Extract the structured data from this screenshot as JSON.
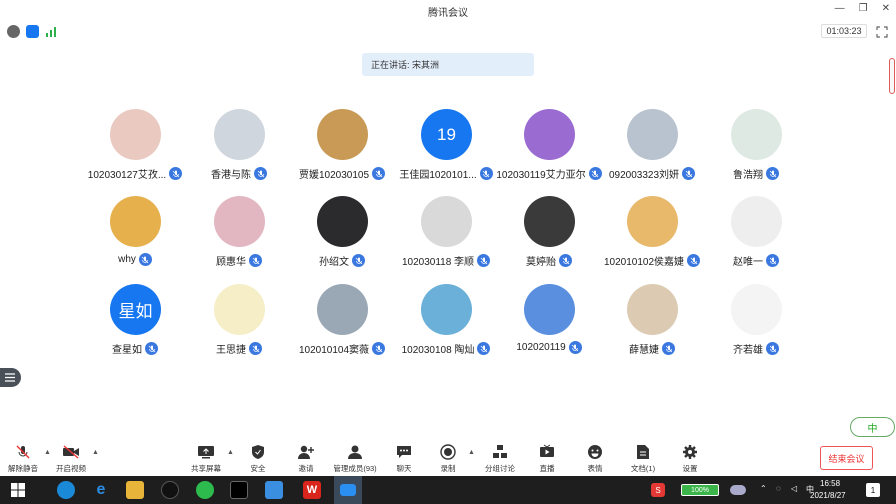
{
  "window": {
    "title": "腾讯会议"
  },
  "status": {
    "timer": "01:03:23"
  },
  "speaking": {
    "label": "正在讲话: 宋其洲"
  },
  "participants": [
    {
      "name": "102030127艾孜...",
      "avatar_text": "",
      "avatar_color": "#e9c9c0"
    },
    {
      "name": "香港与陈",
      "avatar_text": "",
      "avatar_color": "#cfd6de"
    },
    {
      "name": "贾媛102030105",
      "avatar_text": "",
      "avatar_color": "#c89a56"
    },
    {
      "name": "王佳园1020101...",
      "avatar_text": "19",
      "avatar_color": "#1677f0"
    },
    {
      "name": "102030119艾力亚尔",
      "avatar_text": "",
      "avatar_color": "#9a6bd0"
    },
    {
      "name": "092003323刘妍",
      "avatar_text": "",
      "avatar_color": "#b9c3cf"
    },
    {
      "name": "鲁浩翔",
      "avatar_text": "",
      "avatar_color": "#dfe9e3"
    },
    {
      "name": "why",
      "avatar_text": "",
      "avatar_color": "#e6b04d"
    },
    {
      "name": "顾惠华",
      "avatar_text": "",
      "avatar_color": "#e3b7c2"
    },
    {
      "name": "孙绍文",
      "avatar_text": "",
      "avatar_color": "#2b2b2e"
    },
    {
      "name": "102030118 李顺",
      "avatar_text": "",
      "avatar_color": "#d9d9d9"
    },
    {
      "name": "莫婷贻",
      "avatar_text": "",
      "avatar_color": "#3a3a3a"
    },
    {
      "name": "102010102侯嘉婕",
      "avatar_text": "",
      "avatar_color": "#e8b86b"
    },
    {
      "name": "赵唯一",
      "avatar_text": "",
      "avatar_color": "#eeeeee"
    },
    {
      "name": "查星如",
      "avatar_text": "星如",
      "avatar_color": "#1677f0"
    },
    {
      "name": "王思捷",
      "avatar_text": "",
      "avatar_color": "#f6eec7"
    },
    {
      "name": "102010104窦薇",
      "avatar_text": "",
      "avatar_color": "#9aa7b4"
    },
    {
      "name": "102030108 陶灿",
      "avatar_text": "",
      "avatar_color": "#6bb0d9"
    },
    {
      "name": "102020119",
      "avatar_text": "",
      "avatar_color": "#5a8fe0"
    },
    {
      "name": "薛慧婕",
      "avatar_text": "",
      "avatar_color": "#dccbb2"
    },
    {
      "name": "齐若雄",
      "avatar_text": "",
      "avatar_color": "#f4f4f4"
    }
  ],
  "lang_badge": "中",
  "toolbar": {
    "unmute": "解除静音",
    "video": "开启视频",
    "share": "共享屏幕",
    "security": "安全",
    "invite": "邀请",
    "members": "管理成员(93)",
    "chat": "聊天",
    "record": "录制",
    "breakout": "分组讨论",
    "live": "直播",
    "emoji": "表情",
    "docs": "文档(1)",
    "settings": "设置",
    "end": "结束会议"
  },
  "taskbar": {
    "battery": "100%",
    "time": "16:58",
    "date": "2021/8/27",
    "notif_count": "1"
  },
  "colors": {
    "accent": "#1677f0",
    "end_red": "#e33333",
    "speaking_bg": "#e3eefb"
  }
}
